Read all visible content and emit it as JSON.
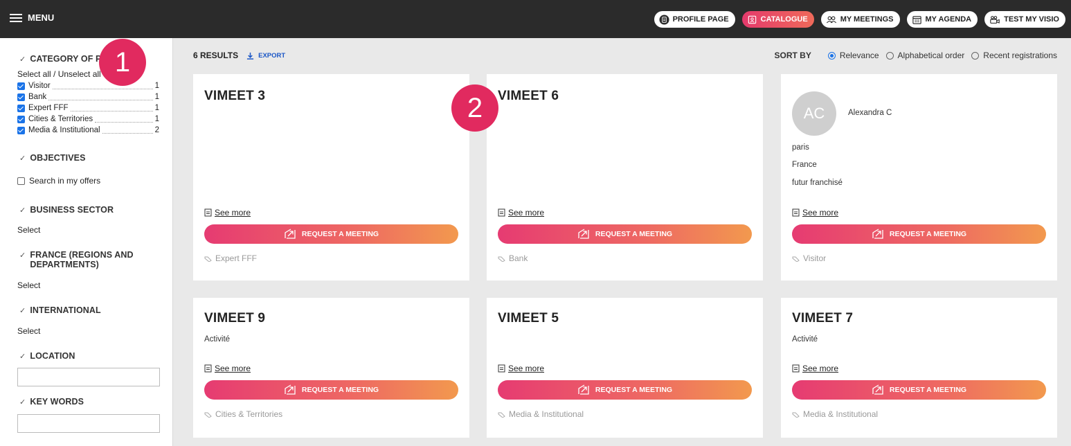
{
  "topbar": {
    "menu_label": "MENU",
    "nav": [
      {
        "label": "PROFILE PAGE",
        "icon": "document-icon",
        "active": false
      },
      {
        "label": "CATALOGUE",
        "icon": "catalogue-icon",
        "active": true
      },
      {
        "label": "MY MEETINGS",
        "icon": "people-icon",
        "active": false
      },
      {
        "label": "MY AGENDA",
        "icon": "calendar-icon",
        "active": false
      },
      {
        "label": "TEST MY VISIO",
        "icon": "video-icon",
        "active": false
      }
    ]
  },
  "sidebar": {
    "category_title": "CATEGORY OF PAR",
    "select_all": "Select all / Unselect all",
    "categories": [
      {
        "label": "Visitor",
        "count": "1"
      },
      {
        "label": "Bank",
        "count": "1"
      },
      {
        "label": "Expert FFF",
        "count": "1"
      },
      {
        "label": "Cities & Territories",
        "count": "1"
      },
      {
        "label": "Media & Institutional",
        "count": "2"
      }
    ],
    "objectives_title": "OBJECTIVES",
    "search_offers": "Search in my offers",
    "business_title": "BUSINESS SECTOR",
    "business_select": "Select",
    "france_title_1": "FRANCE (REGIONS AND",
    "france_title_2": "DEPARTMENTS)",
    "france_select": "Select",
    "international_title": "INTERNATIONAL",
    "international_select": "Select",
    "location_title": "LOCATION",
    "location_value": "",
    "keywords_title": "KEY WORDS",
    "keywords_value": ""
  },
  "results": {
    "count_label": "6 RESULTS",
    "export_label": "EXPORT"
  },
  "sort": {
    "label": "SORT BY",
    "options": [
      "Relevance",
      "Alphabetical order",
      "Recent registrations"
    ],
    "selected": "Relevance"
  },
  "cards": [
    {
      "title": "VIMEET 3",
      "sub": "",
      "see_more": "See more",
      "button": "REQUEST A MEETING",
      "tag": "Expert FFF"
    },
    {
      "title": "VIMEET 6",
      "sub": "",
      "see_more": "See more",
      "button": "REQUEST A MEETING",
      "tag": "Bank"
    },
    {
      "avatar": "AC",
      "name": "Alexandra C",
      "city": "paris",
      "country": "France",
      "status": "futur franchisé",
      "see_more": "See more",
      "button": "REQUEST A MEETING",
      "tag": "Visitor"
    },
    {
      "title": "VIMEET 9",
      "sub": "Activité",
      "see_more": "See more",
      "button": "REQUEST A MEETING",
      "tag": "Cities & Territories"
    },
    {
      "title": "VIMEET 5",
      "sub": "",
      "see_more": "See more",
      "button": "REQUEST A MEETING",
      "tag": "Media & Institutional"
    },
    {
      "title": "VIMEET 7",
      "sub": "Activité",
      "see_more": "See more",
      "button": "REQUEST A MEETING",
      "tag": "Media & Institutional"
    }
  ],
  "badges": [
    "1",
    "2"
  ],
  "colors": {
    "accent": "#e43a6c",
    "gradient_end": "#f2994e",
    "topbar": "#2b2b2b",
    "checkbox": "#1a73e8",
    "badge": "#e12a5f"
  }
}
